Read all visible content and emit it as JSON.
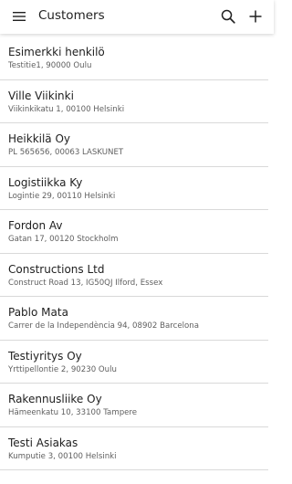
{
  "header": {
    "title": "Customers",
    "icons": {
      "menu": "menu-icon",
      "search": "search-icon",
      "add": "plus-icon"
    }
  },
  "customers": [
    {
      "name": "Esimerkki henkilö",
      "address": "Testitie1, 90000 Oulu"
    },
    {
      "name": "Ville Viikinki",
      "address": "Viikinkikatu 1, 00100 Helsinki"
    },
    {
      "name": "Heikkilä Oy",
      "address": "PL 565656, 00063 LASKUNET"
    },
    {
      "name": "Logistiikka Ky",
      "address": "Logintie 29, 00110 Helsinki"
    },
    {
      "name": "Fordon Av",
      "address": "Gatan 17, 00120 Stockholm"
    },
    {
      "name": "Constructions Ltd",
      "address": "Construct Road 13, IG50QJ Ilford, Essex"
    },
    {
      "name": "Pablo Mata",
      "address": "Carrer de la Independència 94, 08902 Barcelona"
    },
    {
      "name": "Testiyritys Oy",
      "address": "Yrttipellontie 2, 90230 Oulu"
    },
    {
      "name": "Rakennusliike Oy",
      "address": "Hämeenkatu 10, 33100 Tampere"
    },
    {
      "name": "Testi Asiakas",
      "address": "Kumputie 3, 00100 Helsinki"
    }
  ]
}
